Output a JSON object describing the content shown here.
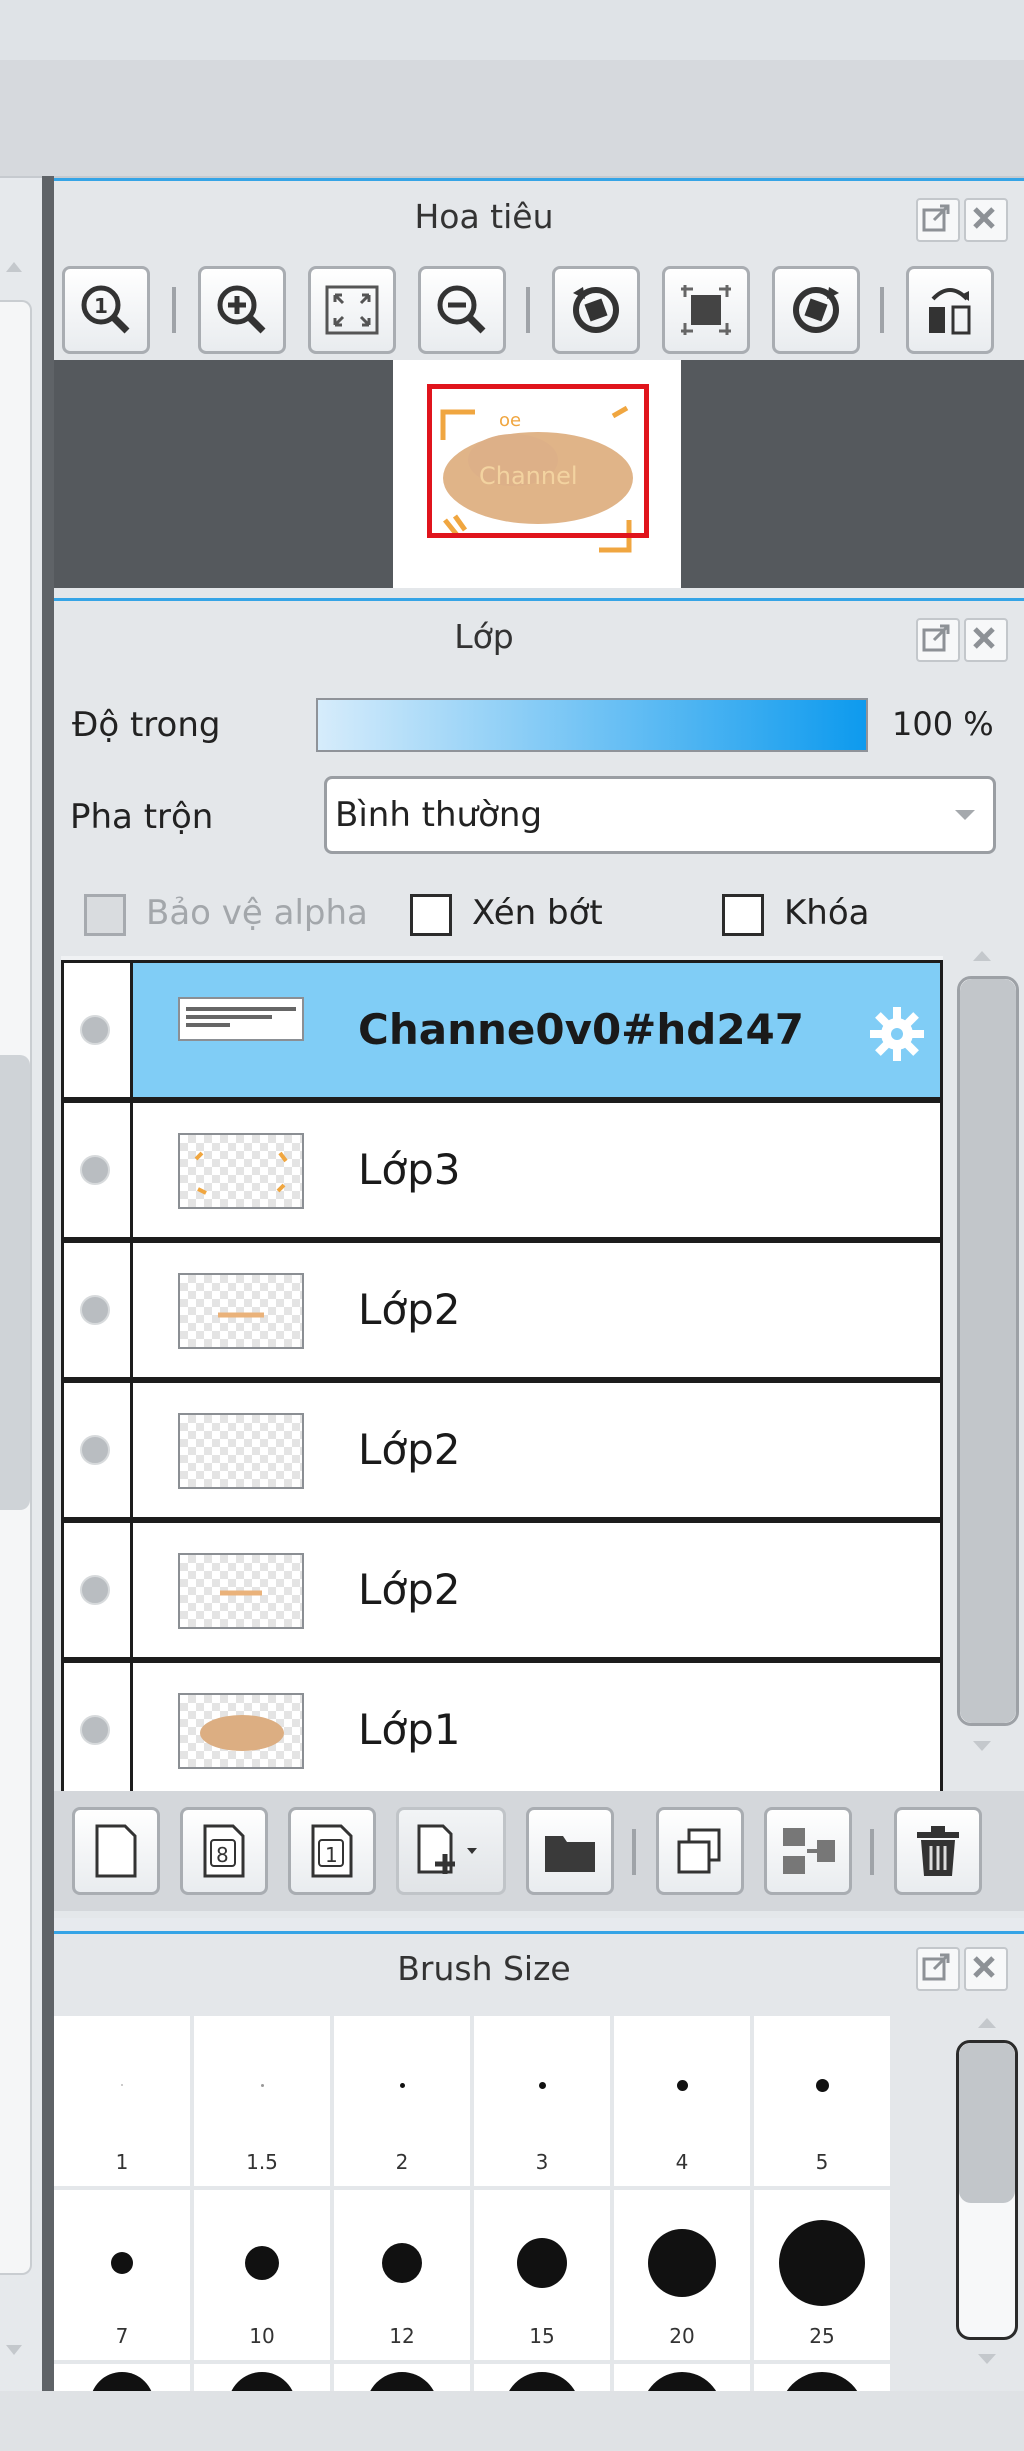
{
  "navigator": {
    "title": "Hoa tiêu",
    "tools": [
      "zoom-actual-icon",
      "zoom-in-icon",
      "fit-to-window-icon",
      "zoom-out-icon",
      "rotate-left-icon",
      "reset-rotation-icon",
      "rotate-right-icon",
      "flip-horizontal-icon"
    ]
  },
  "layers": {
    "title": "Lớp",
    "opacity_label": "Độ trong",
    "opacity_value": "100 %",
    "opacity_fraction": 1.0,
    "blend_label": "Pha trộn",
    "blend_value": "Bình thường",
    "protect_alpha_label": "Bảo vệ alpha",
    "clipping_label": "Xén bớt",
    "lock_label": "Khóa",
    "items": [
      {
        "name": "Channe0v0#hd247",
        "selected": true
      },
      {
        "name": "Lớp3",
        "selected": false
      },
      {
        "name": "Lớp2",
        "selected": false
      },
      {
        "name": "Lớp2",
        "selected": false
      },
      {
        "name": "Lớp2",
        "selected": false
      },
      {
        "name": "Lớp1",
        "selected": false
      }
    ],
    "toolbar": [
      "new-layer-icon",
      "new-8bit-layer-icon",
      "new-1bit-layer-icon",
      "add-layer-menu-icon",
      "new-folder-icon",
      "duplicate-layer-icon",
      "merge-down-icon",
      "delete-layer-icon"
    ]
  },
  "brush_size": {
    "title": "Brush Size",
    "row1": [
      "1",
      "1.5",
      "2",
      "3",
      "4",
      "5"
    ],
    "row2": [
      "7",
      "10",
      "12",
      "15",
      "20",
      "25"
    ]
  },
  "colors": {
    "accent": "#35a4e6",
    "selection": "#80cdf6",
    "view_rect": "#e0141c"
  }
}
